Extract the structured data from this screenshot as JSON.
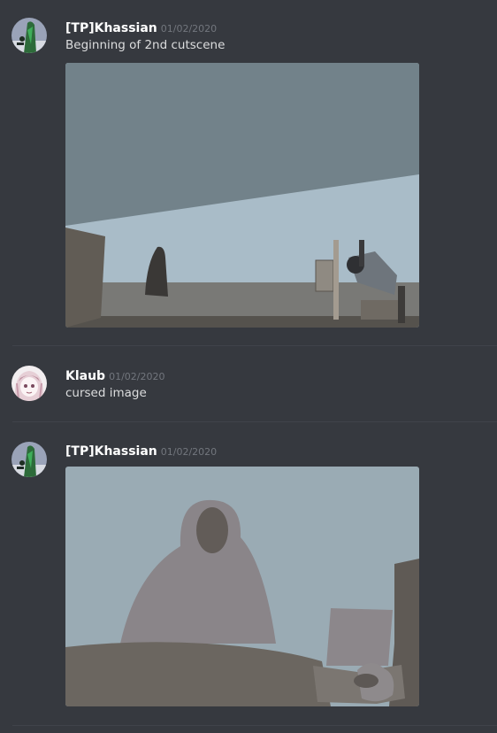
{
  "messages": [
    {
      "author": "[TP]Khassian",
      "timestamp": "01/02/2020",
      "content": "Beginning of 2nd cutscene",
      "avatar_icon": "green-character-avatar",
      "attachment": "cutscene-room-image"
    },
    {
      "author": "Klaub",
      "timestamp": "01/02/2020",
      "content": "cursed image",
      "avatar_icon": "anime-girl-avatar"
    },
    {
      "author": "[TP]Khassian",
      "timestamp": "01/02/2020",
      "content": "",
      "avatar_icon": "green-character-avatar",
      "attachment": "cloaked-figure-closeup-image"
    }
  ],
  "colors": {
    "background": "#36393f",
    "author": "#ffffff",
    "timestamp": "#72767d",
    "text": "#dcddde"
  }
}
